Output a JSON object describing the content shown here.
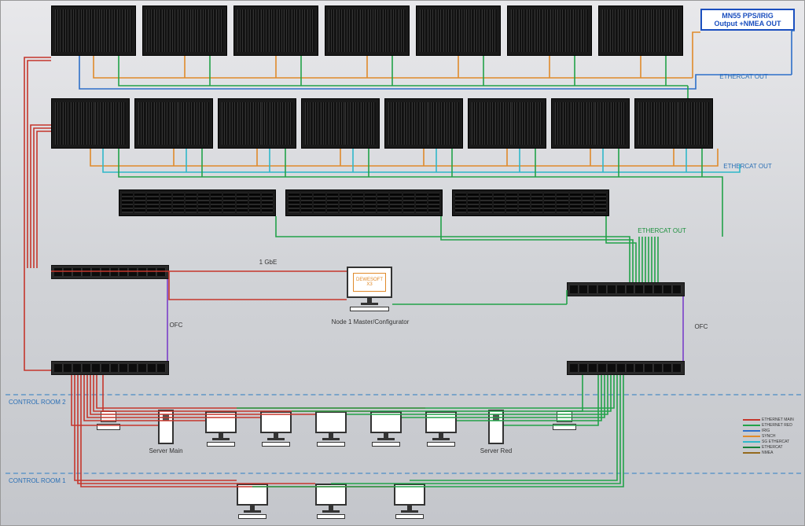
{
  "ext_box": {
    "line1": "MN55 PPS/IRIG",
    "line2": "Output +NMEA OUT"
  },
  "labels": {
    "ethercat_out_top": "ETHERCAT OUT",
    "ethercat_out_mid": "ETHERCAT OUT",
    "ethercat_out_mid2": "ETHERCAT OUT",
    "master_sw": "DEWESOFT X3",
    "master_caption": "Node 1 Master/Configurator",
    "ofc_left": "OFC",
    "ofc_right": "OFC",
    "control_room_2": "CONTROL ROOM 2",
    "control_room_1": "CONTROL ROOM 1",
    "server_main": "Server Main",
    "server_red": "Server Red",
    "one_gbe": "1 GbE"
  },
  "legend": [
    {
      "name": "ETHERNET MAIN",
      "color": "#c5362c"
    },
    {
      "name": "ETHERNET RED",
      "color": "#22a249"
    },
    {
      "name": "IRIG",
      "color": "#2d6fc9"
    },
    {
      "name": "SYNCH",
      "color": "#e08a2a"
    },
    {
      "name": "SG ETHERCAT",
      "color": "#2fb8c9"
    },
    {
      "name": "ETHERCAT",
      "color": "#178038"
    },
    {
      "name": "NMEA",
      "color": "#946a1e"
    }
  ],
  "racks_row1": [
    0,
    1,
    2,
    3,
    4,
    5,
    6
  ],
  "racks_row2": [
    0,
    1,
    2,
    3,
    4,
    5,
    6,
    7
  ],
  "racks_1u": [
    0,
    1,
    2
  ],
  "switches": [
    0,
    1,
    2,
    3
  ],
  "clients_row2": [
    0,
    1,
    2,
    3,
    4
  ],
  "clients_row1": [
    0,
    1,
    2
  ]
}
